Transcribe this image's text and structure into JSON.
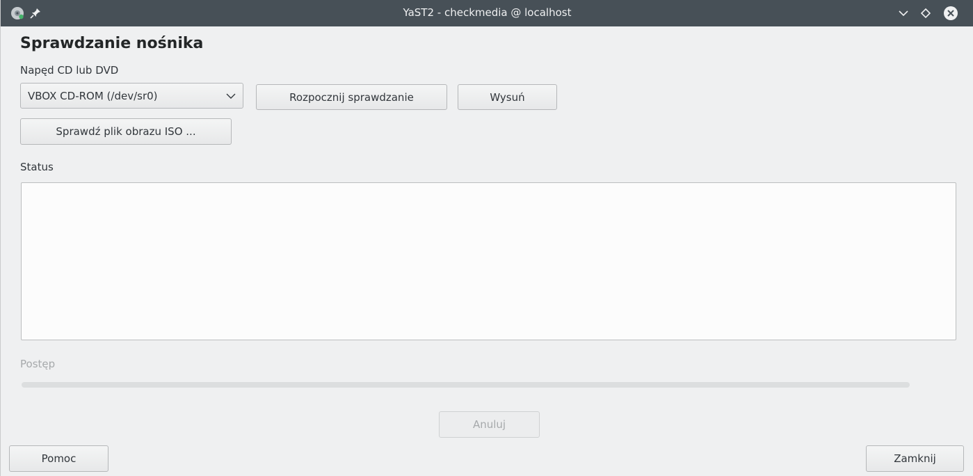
{
  "window": {
    "title": "YaST2 - checkmedia @ localhost"
  },
  "page": {
    "heading": "Sprawdzanie nośnika",
    "drive_label": "Napęd CD lub DVD",
    "drive_select": {
      "selected": "VBOX CD-ROM (/dev/sr0)"
    },
    "start_button": "Rozpocznij sprawdzanie",
    "eject_button": "Wysuń",
    "iso_button": "Sprawdź plik obrazu ISO ...",
    "status_label": "Status",
    "status_text": "",
    "progress_label": "Postęp",
    "progress_value": 0,
    "cancel_button": "Anuluj"
  },
  "footer": {
    "help_button": "Pomoc",
    "close_button": "Zamknij"
  },
  "icons": {
    "app": "disc-icon",
    "pin": "pin-icon",
    "minimize": "chevron-down-icon",
    "maximize": "diamond-icon",
    "close": "close-icon"
  },
  "colors": {
    "titlebar": "#475057",
    "accent": "#3daee9",
    "background": "#eff0f1"
  }
}
